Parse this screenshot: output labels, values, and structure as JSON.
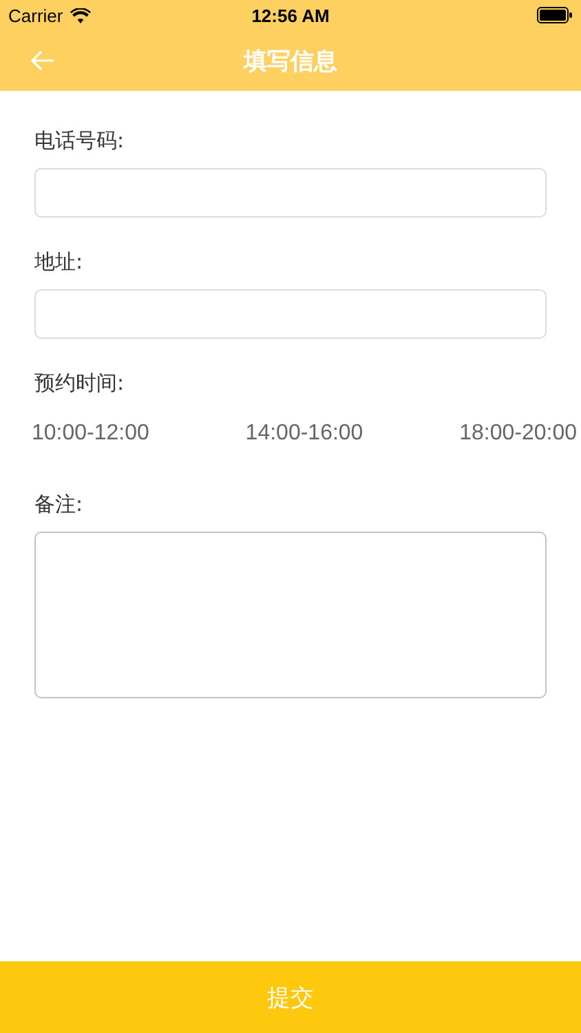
{
  "status_bar": {
    "carrier": "Carrier",
    "time": "12:56 AM"
  },
  "nav": {
    "title": "填写信息"
  },
  "fields": [
    {
      "label": "电话号码:",
      "kind": "input"
    },
    {
      "label": "地址:",
      "kind": "input"
    }
  ],
  "appointment": {
    "label": "预约时间:",
    "slots": [
      {
        "label": "10:00-12:00",
        "selected": false
      },
      {
        "label": "14:00-16:00",
        "selected": false
      },
      {
        "label": "18:00-20:00",
        "selected": false
      }
    ]
  },
  "notes": {
    "label": "备注:",
    "kind": "textarea"
  },
  "submit": "提交"
}
